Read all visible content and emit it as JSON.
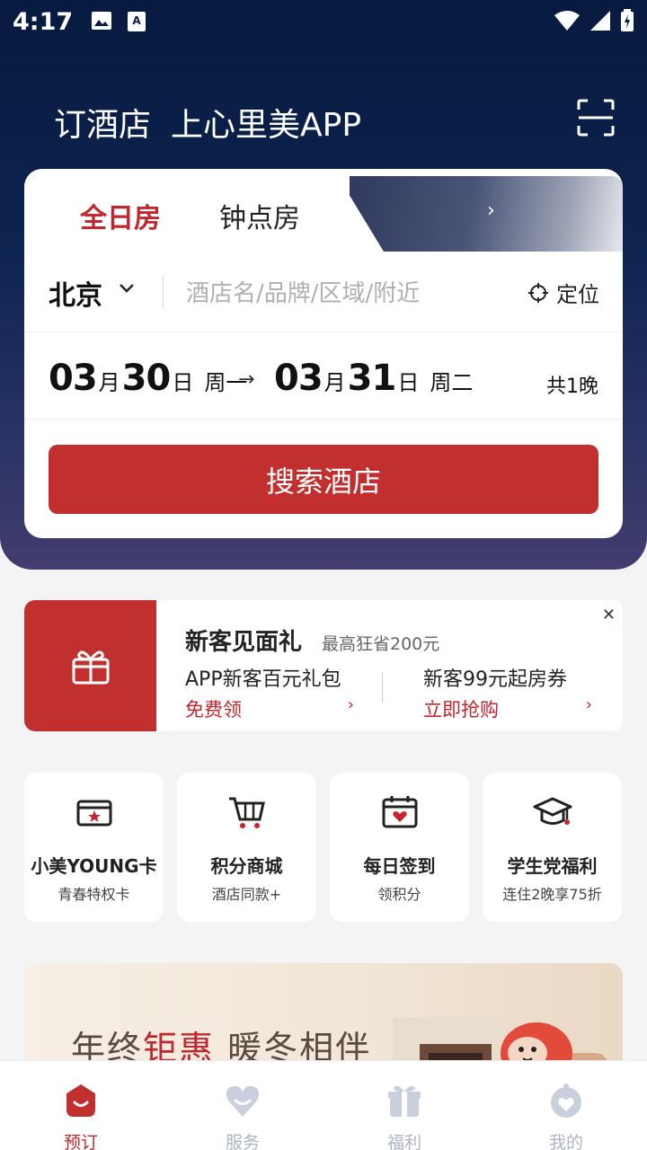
{
  "status_bar": {
    "time": "4:17"
  },
  "header": {
    "title": "订酒店",
    "brand": "上心里美APP"
  },
  "booking": {
    "tabs": [
      "全日房",
      "钟点房"
    ],
    "city": "北京",
    "search_placeholder": "酒店名/品牌/区域/附近",
    "locate_label": "定位",
    "checkin": {
      "month": "03",
      "month_unit": "月",
      "day": "30",
      "day_unit": "日",
      "weekday": "周一"
    },
    "checkout": {
      "month": "03",
      "month_unit": "月",
      "day": "31",
      "day_unit": "日",
      "weekday": "周二"
    },
    "arrow": "→",
    "nights": "共1晚",
    "search_button": "搜索酒店"
  },
  "promo": {
    "title": "新客见面礼",
    "subtitle": "最高狂省200元",
    "offers": [
      {
        "name": "APP新客百元礼包",
        "action": "免费领"
      },
      {
        "name": "新客99元起房券",
        "action": "立即抢购"
      }
    ]
  },
  "quick_links": [
    {
      "title": "小美YOUNG卡",
      "subtitle": "青春特权卡",
      "icon": "young-card-icon"
    },
    {
      "title": "积分商城",
      "subtitle": "酒店同款+",
      "icon": "cart-icon"
    },
    {
      "title": "每日签到",
      "subtitle": "领积分",
      "icon": "calendar-icon"
    },
    {
      "title": "学生党福利",
      "subtitle": "连住2晚享75折",
      "icon": "graduation-cap-icon"
    }
  ],
  "banner": {
    "text_prefix": "年终",
    "text_highlight": "钜惠",
    "text_suffix": " 暖冬相伴"
  },
  "bottom_nav": [
    {
      "label": "预订",
      "icon": "booking-icon",
      "active": true
    },
    {
      "label": "服务",
      "icon": "service-icon",
      "active": false
    },
    {
      "label": "福利",
      "icon": "gift-icon",
      "active": false
    },
    {
      "label": "我的",
      "icon": "profile-icon",
      "active": false
    }
  ],
  "colors": {
    "accent": "#c1302f",
    "hero": "#0e2450",
    "inactive_nav": "#aeb4c4"
  }
}
